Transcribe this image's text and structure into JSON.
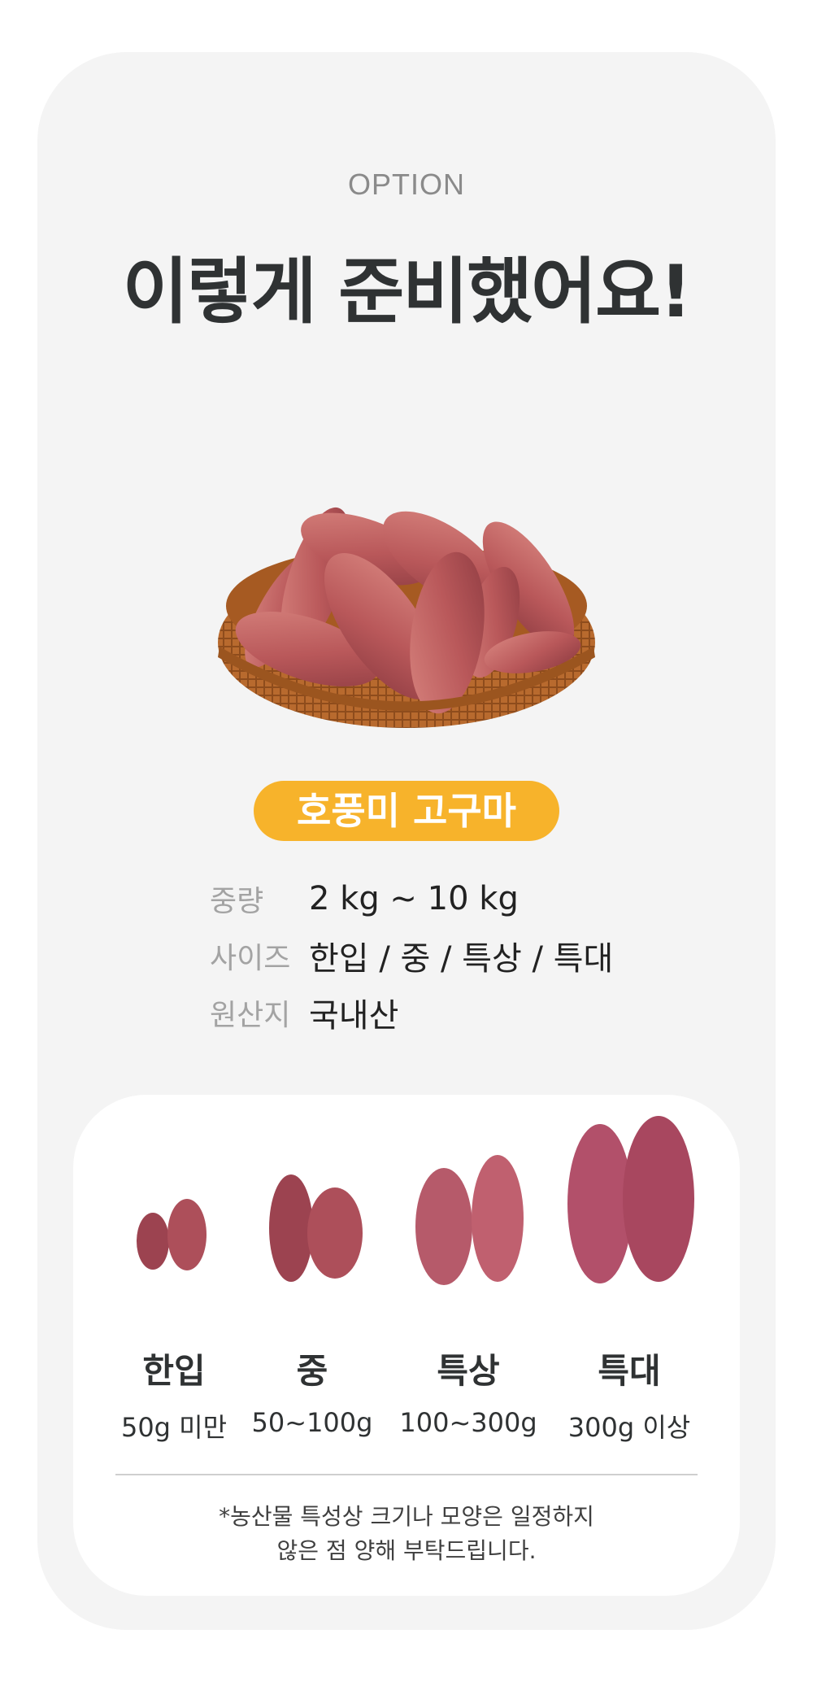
{
  "header": {
    "eyebrow": "OPTION",
    "title": "이렇게 준비했어요!"
  },
  "product": {
    "name": "호풍미 고구마",
    "badge_color": "#f7b32b",
    "specs": [
      {
        "label": "중량",
        "value": "2 kg ~ 10 kg"
      },
      {
        "label": "사이즈",
        "value": "한입 / 중 / 특상 / 특대"
      },
      {
        "label": "원산지",
        "value": "국내산"
      }
    ]
  },
  "sizes": [
    {
      "name": "한입",
      "weight": "50g 미만"
    },
    {
      "name": "중",
      "weight": "50~100g"
    },
    {
      "name": "특상",
      "weight": "100~300g"
    },
    {
      "name": "특대",
      "weight": "300g 이상"
    }
  ],
  "note": {
    "line1": "*농산물 특성상 크기나 모양은 일정하지",
    "line2": "않은 점 양해 부탁드립니다."
  }
}
